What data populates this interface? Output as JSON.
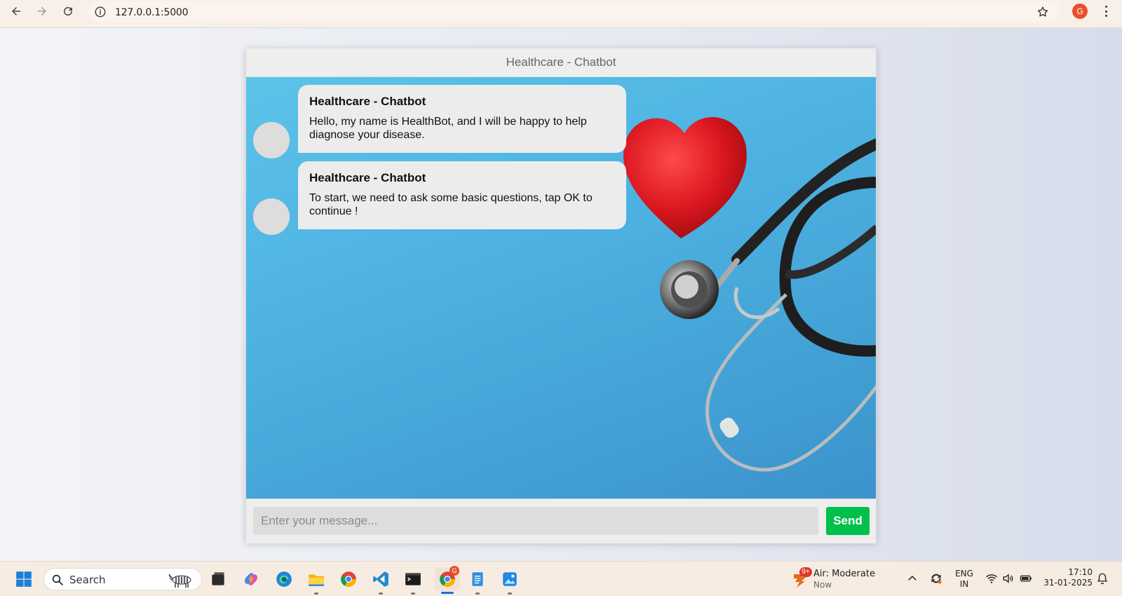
{
  "browser": {
    "url": "127.0.0.1:5000",
    "profile_initial": "G"
  },
  "chat": {
    "title": "Healthcare - Chatbot",
    "messages": [
      {
        "sender": "Healthcare - Chatbot",
        "text": "Hello, my name is HealthBot, and I will be happy to help diagnose your disease."
      },
      {
        "sender": "Healthcare - Chatbot",
        "text": "To start, we need to ask some basic questions, tap OK to continue !"
      }
    ],
    "input_placeholder": "Enter your message...",
    "send_label": "Send",
    "colors": {
      "send_button": "#00c04b",
      "background_sky": "#4cb0e0",
      "heart": "#e0202a"
    }
  },
  "taskbar": {
    "search_label": "Search",
    "pinned_icons": [
      "windows-start-icon",
      "task-view-icon",
      "copilot-icon",
      "edge-icon",
      "file-explorer-icon",
      "chrome-icon",
      "vscode-icon",
      "terminal-icon",
      "chrome-profile-icon",
      "notepad-icon",
      "photos-icon"
    ],
    "chrome_badge": "G",
    "weather": {
      "badge": "9+",
      "title": "Air: Moderate",
      "subtitle": "Now"
    },
    "language": {
      "line1": "ENG",
      "line2": "IN"
    },
    "time": "17:10",
    "date": "31-01-2025"
  }
}
